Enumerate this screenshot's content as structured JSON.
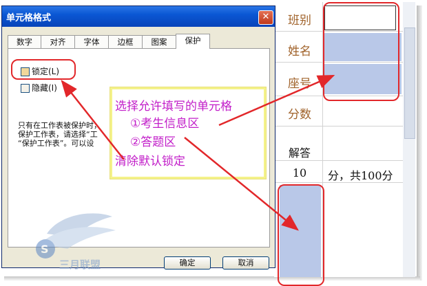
{
  "dialog": {
    "title": "单元格格式",
    "close_glyph": "✕",
    "tabs": [
      "数字",
      "对齐",
      "字体",
      "边框",
      "图案",
      "保护"
    ],
    "active_tab": "保护",
    "checkboxes": [
      {
        "label": "锁定(L)",
        "checked": true
      },
      {
        "label": "隐藏(I)",
        "checked": false
      }
    ],
    "description_lines": [
      "只有在工作表被保护时，",
      "保护工作表，请选择“工",
      "“保护工作表”。可以设"
    ],
    "ok_label": "确定",
    "cancel_label": "取消"
  },
  "sheet": {
    "labels": [
      "班别",
      "姓名",
      "座号",
      "分数"
    ],
    "answer_label": "解答",
    "score_value": "10",
    "score_text": "分，共100分"
  },
  "annotation": {
    "lines": [
      "选择允许填写的单元格",
      "①考生信息区",
      "②答题区",
      "清除默认锁定"
    ]
  },
  "watermark": {
    "text": "三月联盟"
  },
  "colors": {
    "annotation_text": "#c21ec9",
    "highlight_red": "#e2272a",
    "cell_blue": "#b9c8e8",
    "label_brown": "#a0622a"
  }
}
